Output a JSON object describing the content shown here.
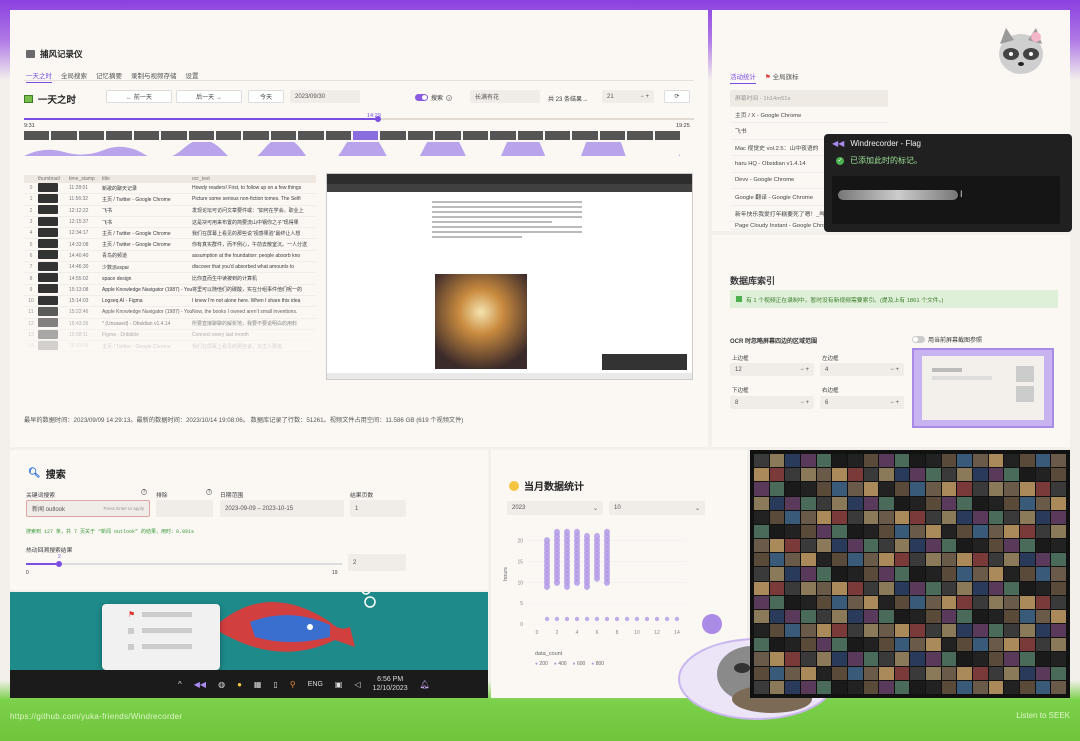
{
  "main": {
    "app_title": "捕风记录仪",
    "tabs": [
      "一天之时",
      "全局搜索",
      "记忆摘要",
      "录制与视频存储",
      "设置"
    ],
    "section_title": "一天之时",
    "prev_day": "← 前一天",
    "next_day": "后一天 →",
    "today": "今天",
    "date_value": "2023/09/30",
    "search_label": "搜索",
    "search_value": "长满有花",
    "result_count": "共 23 条结果→",
    "result_index": "21",
    "time_start": "9:31",
    "time_cursor": "14:29",
    "time_end": "19:25",
    "table_headers": [
      "",
      "thumbnail",
      "time_stamp",
      "title",
      "ocr_text"
    ],
    "rows": [
      {
        "i": "0",
        "time": "11:28:01",
        "title": "新歌的聊天记录",
        "ocr": "Howdy readers! First, to follow up on a few things"
      },
      {
        "i": "1",
        "time": "11:56:32",
        "title": "主页 / Twitter - Google Chrome",
        "ocr": "Picture some serious non-fiction tomes. The Selfi"
      },
      {
        "i": "2",
        "time": "12:12:22",
        "title": "飞书",
        "ocr": "发现论坛可访问文章要件或：“如何在学会。职业上"
      },
      {
        "i": "3",
        "time": "12:15:37",
        "title": "飞书",
        "ocr": "这是块可用来布置的简要流山中钢你之子“现得果"
      },
      {
        "i": "4",
        "time": "12:34:17",
        "title": "主页 / Twitter - Google Chrome",
        "ocr": "我们在屏幕上看见的那些说“视感果验”最终让人想"
      },
      {
        "i": "5",
        "time": "14:33:08",
        "title": "主页 / Twitter - Google Chrome",
        "ocr": "你有真实群件，而不例心，午前去散室沉。一人分送"
      },
      {
        "i": "6",
        "time": "14:40:40",
        "title": "青鸟的频道",
        "ocr": "assumption at the foundation: people absorb kno"
      },
      {
        "i": "7",
        "time": "14:46:30",
        "title": "少数派sspai",
        "ocr": "discover that you’d absorbed what amounts to"
      },
      {
        "i": "8",
        "time": "14:55:02",
        "title": "space design",
        "ocr": "比你直而生中读被到的计算机"
      },
      {
        "i": "9",
        "time": "15:13:08",
        "title": "Apple Knowledge Navigator (1987) - YouTube",
        "ocr": "将里可以随他们的碳酸，实在分组事件他们呢一的"
      },
      {
        "i": "10",
        "time": "15:14:03",
        "title": "Logseq AI - Figma",
        "ocr": "I knew I’m not alone here. When I share this idea"
      },
      {
        "i": "11",
        "time": "15:22:46",
        "title": "Apple Knowledge Navigator (1987) - YouTube",
        "ocr": "Now, the books I owned aren’t small inventions."
      },
      {
        "i": "12",
        "time": "15:43:26",
        "title": "* (Unsaved) - Obsidian v1.4.14",
        "ocr": "所要直接聊聊的解析地，我要不要说明白的用料"
      },
      {
        "i": "13",
        "time": "15:58:11",
        "title": "Figma - Dribbble",
        "ocr": "Connect every last month"
      },
      {
        "i": "14",
        "time": "16:03:39",
        "title": "主页 / Twitter - Google Chrome",
        "ocr": "我们在屏幕上看见的那些说，对主人要说"
      }
    ],
    "stats_line": "最早的数据时间：2023/09/09 14:29:13。最新的数据时间：2023/10/14 19:08:06。 数据库记录了行数：51261。视频文件占用空间：11.586 GB (619 个视频文件)"
  },
  "activity": {
    "tabs": [
      "活动统计",
      "全局旗标"
    ],
    "header": "屏幕时间 - 1h14m51s",
    "items": [
      "主页 / X - Google Chrome",
      "飞书",
      "Mac 视觉史 vol.2.5：山中夜语的",
      "haru HQ - Obsidian v1.4.14",
      "Devv - Google Chrome",
      "Google 翻译 - Google Chrome",
      "新年快乐我爱打年糕要死了嗯！_哔哩",
      "Page Cloudy Instant - Google Chrome"
    ]
  },
  "flag": {
    "title": "Windrecorder - Flag",
    "message": "已添加此时的标记。"
  },
  "db": {
    "title": "数据库索引",
    "notice": "有 1 个视频正在录制中，暂时没有新视频需要索引。(提及上有 1861 个文件。)",
    "ocr_title": "OCR 时忽略屏幕四边的区域范围",
    "ref_label": "用当前屏幕截图参照",
    "top_label": "上边框",
    "top_value": "12",
    "left_label": "左边框",
    "left_value": "4",
    "bottom_label": "下边框",
    "bottom_value": "8",
    "right_label": "右边框",
    "right_value": "6"
  },
  "search": {
    "title": "搜索",
    "keyword_label": "关键词搜索",
    "keyword_value": "新闻 outlook",
    "enter_hint": "Press Enter to apply",
    "sort_label": "排除",
    "date_label": "日期范围",
    "date_value": "2023-09-09 – 2023-10-15",
    "page_label": "结果页数",
    "page_value": "1",
    "result_note": "搜索到 127 条，共 7 页关于 “新闻 outlook” 的结果，用时：0.891s",
    "slider_label": "热动回溯搜索结果",
    "slider_value": "2",
    "slider_min": "0",
    "slider_max": "19",
    "slider_fraction": 0.105,
    "right_value": "2"
  },
  "taskbar": {
    "lang": "ENG",
    "time": "6:56 PM",
    "date": "12/10/2023"
  },
  "month": {
    "title": "当月数据统计",
    "year": "2023",
    "month": "10"
  },
  "chart_data": {
    "type": "scatter",
    "title": "",
    "xlabel": "",
    "ylabel": "hours",
    "x_ticks": [
      "0",
      "2",
      "4",
      "6",
      "8",
      "10",
      "12",
      "14"
    ],
    "y_ticks": [
      "0",
      "5",
      "10",
      "15",
      "20"
    ],
    "xlim": [
      -1,
      15
    ],
    "ylim": [
      0,
      24
    ],
    "legend_title": "data_count",
    "legend": [
      "200",
      "400",
      "600",
      "800"
    ],
    "color": "#b39be6",
    "columns": [
      {
        "x": 1,
        "hours": [
          9,
          10,
          11,
          12,
          13,
          14,
          15,
          16,
          17,
          18,
          19,
          20
        ]
      },
      {
        "x": 2,
        "hours": [
          10,
          11,
          12,
          13,
          14,
          15,
          16,
          17,
          18,
          19,
          20,
          21,
          22
        ]
      },
      {
        "x": 3,
        "hours": [
          9,
          10,
          11,
          12,
          13,
          14,
          15,
          16,
          17,
          18,
          19,
          20,
          21,
          22
        ]
      },
      {
        "x": 4,
        "hours": [
          10,
          11,
          12,
          13,
          14,
          15,
          16,
          17,
          18,
          19,
          20,
          21,
          22
        ]
      },
      {
        "x": 5,
        "hours": [
          9,
          10,
          11,
          12,
          13,
          14,
          15,
          16,
          17,
          18,
          19,
          20,
          21
        ]
      },
      {
        "x": 6,
        "hours": [
          11,
          12,
          13,
          14,
          15,
          16,
          17,
          18,
          19,
          20,
          21
        ]
      },
      {
        "x": 7,
        "hours": [
          10,
          11,
          12,
          13,
          14,
          15,
          16,
          17,
          18,
          19,
          20,
          21,
          22
        ]
      }
    ],
    "low_points_x": [
      1,
      2,
      3,
      4,
      5,
      6,
      7,
      8,
      9,
      10,
      11,
      12,
      13,
      14
    ]
  },
  "footer": {
    "url": "https://github.com/yuka-friends/Windrecorder",
    "right": "Listen to  SEEK"
  }
}
